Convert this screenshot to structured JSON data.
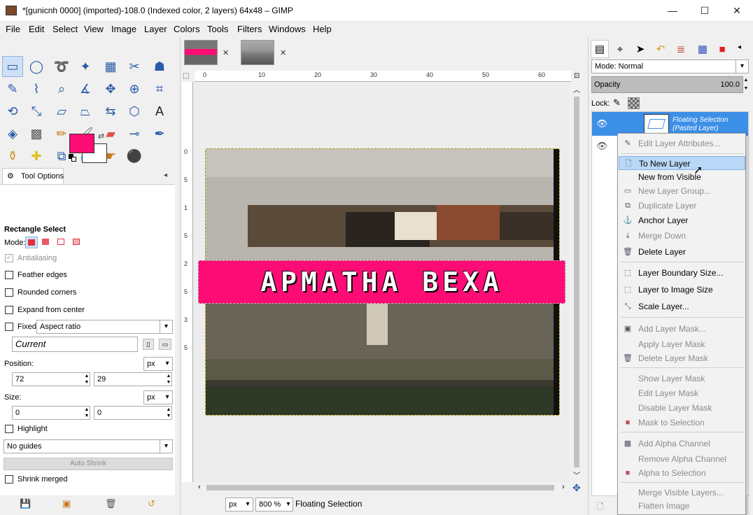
{
  "window": {
    "title": "*[gunicnh 0000] (imported)-108.0 (Indexed color, 2 layers) 64x48 – GIMP",
    "minimize": "—",
    "maximize": "☐",
    "close": "✕"
  },
  "menubar": [
    "File",
    "Edit",
    "Select",
    "View",
    "Image",
    "Layer",
    "Colors",
    "Tools",
    "Filters",
    "Windows",
    "Help"
  ],
  "colors": {
    "foreground": "#fc0c74",
    "background": "#ffffff",
    "selection_highlight": "#3c8fe6"
  },
  "tool_options": {
    "tab_label": "Tool Options",
    "tool_name": "Rectangle Select",
    "mode_label": "Mode:",
    "antialiasing": "Antialiasing",
    "feather_edges": "Feather edges",
    "rounded_corners": "Rounded corners",
    "expand_from_center": "Expand from center",
    "fixed_label": "Fixed:",
    "fixed_value": "Aspect ratio",
    "current_value": "Current",
    "position_label": "Position:",
    "position_unit": "px",
    "position_x": "72",
    "position_y": "29",
    "size_label": "Size:",
    "size_unit": "px",
    "size_w": "0",
    "size_h": "0",
    "highlight": "Highlight",
    "guides": "No guides",
    "auto_shrink": "Auto Shrink",
    "shrink_merged": "Shrink merged"
  },
  "canvas": {
    "banner_text": "APMATHA BEXA",
    "ruler_h": [
      "0",
      "10",
      "20",
      "30",
      "40",
      "50",
      "60"
    ],
    "ruler_v": [
      "0",
      "5",
      "1",
      "5",
      "2",
      "5",
      "3",
      "5"
    ]
  },
  "statusbar": {
    "unit": "px",
    "zoom": "800 %",
    "message": "Floating Selection"
  },
  "layers": {
    "mode_label": "Mode: Normal",
    "opacity_label": "Opacity",
    "opacity_value": "100.0",
    "lock_label": "Lock:",
    "items": [
      {
        "name": "Floating Selection\n(Pasted Layer)",
        "line1": "Floating Selection",
        "line2": "(Pasted Layer)"
      }
    ]
  },
  "context_menu": {
    "items": [
      {
        "label": "Edit Layer Attributes...",
        "disabled": true
      },
      {
        "label": "To New Layer",
        "disabled": false,
        "highlighted": true
      },
      {
        "label": "New from Visible",
        "disabled": false
      },
      {
        "label": "New Layer Group...",
        "disabled": true
      },
      {
        "label": "Duplicate Layer",
        "disabled": true
      },
      {
        "label": "Anchor Layer",
        "disabled": false
      },
      {
        "label": "Merge Down",
        "disabled": true
      },
      {
        "label": "Delete Layer",
        "disabled": false
      },
      {
        "label": "Layer Boundary Size...",
        "disabled": false
      },
      {
        "label": "Layer to Image Size",
        "disabled": false
      },
      {
        "label": "Scale Layer...",
        "disabled": false
      },
      {
        "label": "Add Layer Mask...",
        "disabled": true
      },
      {
        "label": "Apply Layer Mask",
        "disabled": true
      },
      {
        "label": "Delete Layer Mask",
        "disabled": true
      },
      {
        "label": "Show Layer Mask",
        "disabled": true
      },
      {
        "label": "Edit Layer Mask",
        "disabled": true
      },
      {
        "label": "Disable Layer Mask",
        "disabled": true
      },
      {
        "label": "Mask to Selection",
        "disabled": true
      },
      {
        "label": "Add Alpha Channel",
        "disabled": true
      },
      {
        "label": "Remove Alpha Channel",
        "disabled": true
      },
      {
        "label": "Alpha to Selection",
        "disabled": true
      },
      {
        "label": "Merge Visible Layers...",
        "disabled": true
      },
      {
        "label": "Flatten Image",
        "disabled": true
      }
    ]
  }
}
